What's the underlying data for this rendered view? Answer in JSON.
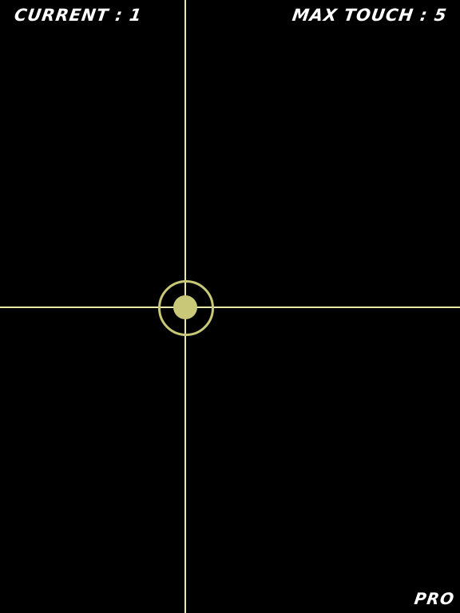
{
  "hud": {
    "current_label": "CURRENT : 1",
    "max_touch_label": "MAX TOUCH : 5",
    "edition_label": "PRO"
  },
  "touch": {
    "current_count": 1,
    "max_count": 5
  },
  "colors": {
    "background": "#000000",
    "text": "#ffffff",
    "crosshair": "#e8e8a8",
    "touch_marker": "#c8c878"
  }
}
